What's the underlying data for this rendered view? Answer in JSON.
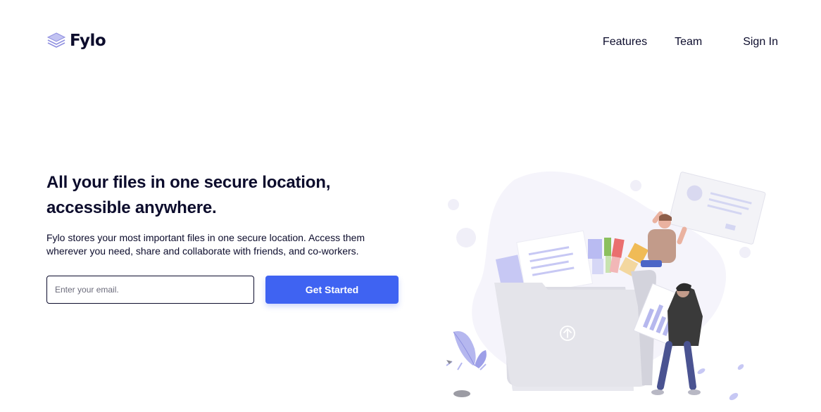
{
  "brand": {
    "name": "Fylo",
    "accent": "#3f63f2",
    "text_color": "#0c0c2c"
  },
  "nav": {
    "items": [
      {
        "label": "Features"
      },
      {
        "label": "Team"
      },
      {
        "label": "Sign In"
      }
    ]
  },
  "hero": {
    "title": "All your files in one secure location, accessible anywhere.",
    "description": "Fylo stores your most important files in one secure location. Access them wherever you need, share and collaborate with friends, and co-workers."
  },
  "signup": {
    "email_placeholder": "Enter your email.",
    "email_value": "",
    "button_label": "Get Started"
  },
  "icons": {
    "logo": "stacked-layers-icon",
    "upload": "upload-arrow-icon"
  }
}
